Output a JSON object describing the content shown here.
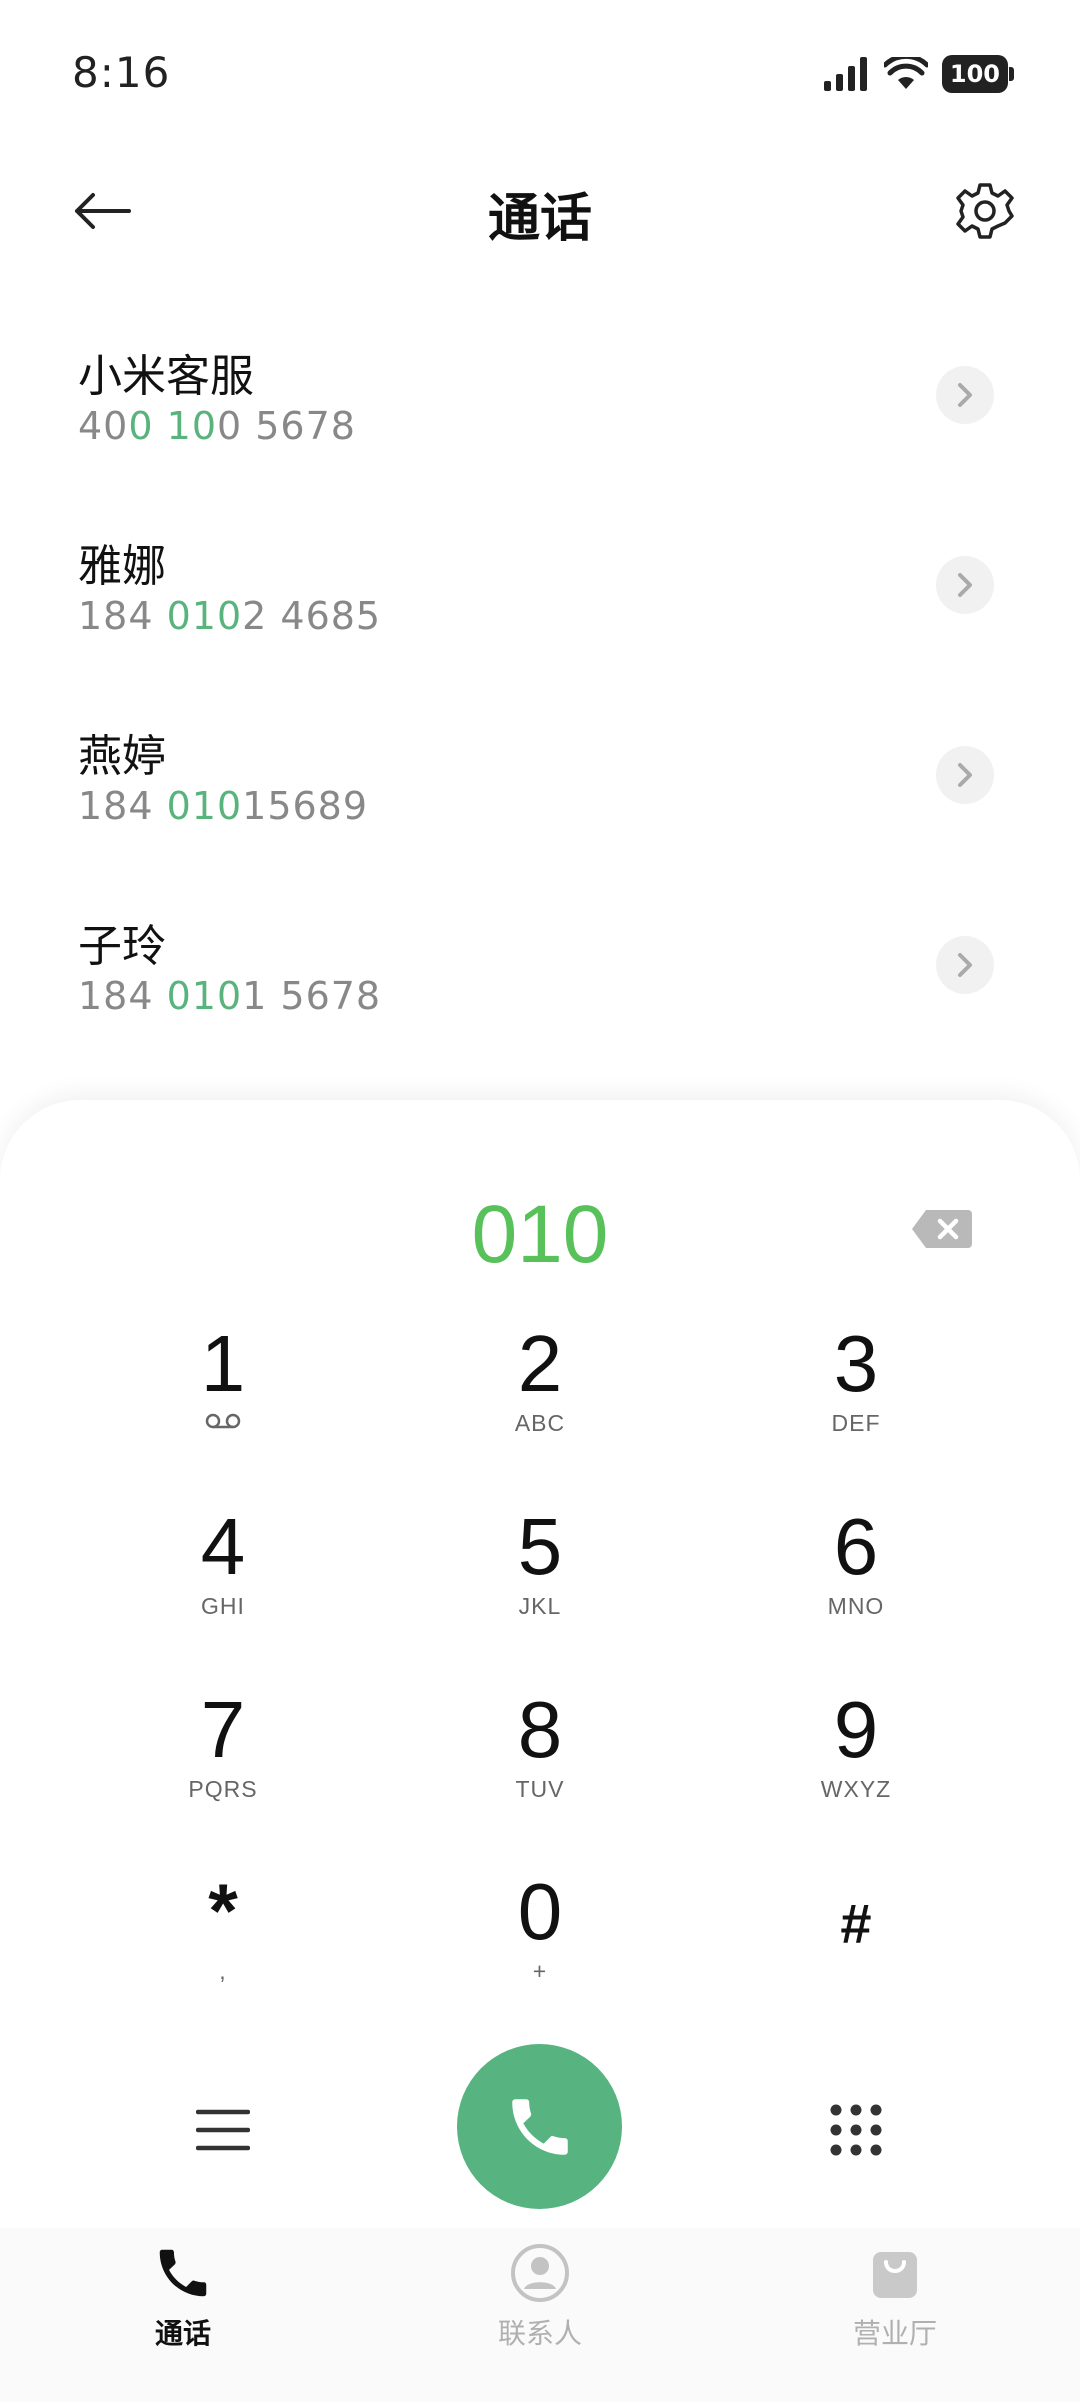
{
  "status_bar": {
    "time": "8:16",
    "battery": "100"
  },
  "header": {
    "title": "通话"
  },
  "results": [
    {
      "name": "小米客服",
      "number_parts": [
        {
          "text": "40",
          "hl": false
        },
        {
          "text": "0",
          "hl": true
        },
        {
          "text": " ",
          "hl": false
        },
        {
          "text": "10",
          "hl": true
        },
        {
          "text": "0 5678",
          "hl": false
        }
      ]
    },
    {
      "name": "雅娜",
      "number_parts": [
        {
          "text": "184 ",
          "hl": false
        },
        {
          "text": "010",
          "hl": true
        },
        {
          "text": "2 4685",
          "hl": false
        }
      ]
    },
    {
      "name": "燕婷",
      "number_parts": [
        {
          "text": "184 ",
          "hl": false
        },
        {
          "text": "010",
          "hl": true
        },
        {
          "text": "15689",
          "hl": false
        }
      ]
    },
    {
      "name": "子玲",
      "number_parts": [
        {
          "text": "184 ",
          "hl": false
        },
        {
          "text": "010",
          "hl": true
        },
        {
          "text": "1 5678",
          "hl": false
        }
      ]
    }
  ],
  "dialer": {
    "input": "010",
    "keys": [
      {
        "digit": "1",
        "letters": "",
        "icon": "voicemail-icon"
      },
      {
        "digit": "2",
        "letters": "ABC"
      },
      {
        "digit": "3",
        "letters": "DEF"
      },
      {
        "digit": "4",
        "letters": "GHI"
      },
      {
        "digit": "5",
        "letters": "JKL"
      },
      {
        "digit": "6",
        "letters": "MNO"
      },
      {
        "digit": "7",
        "letters": "PQRS"
      },
      {
        "digit": "8",
        "letters": "TUV"
      },
      {
        "digit": "9",
        "letters": "WXYZ"
      },
      {
        "digit": "*",
        "letters": ","
      },
      {
        "digit": "0",
        "letters": "+"
      },
      {
        "digit": "#",
        "letters": ""
      }
    ]
  },
  "bottom_nav": [
    {
      "label": "通话",
      "icon": "phone-icon",
      "active": true
    },
    {
      "label": "联系人",
      "icon": "contact-icon",
      "active": false
    },
    {
      "label": "营业厅",
      "icon": "shopping-bag-icon",
      "active": false
    }
  ],
  "colors": {
    "accent_green": "#58b37d",
    "dial_green": "#58c15a",
    "call_button": "#57b37f"
  }
}
